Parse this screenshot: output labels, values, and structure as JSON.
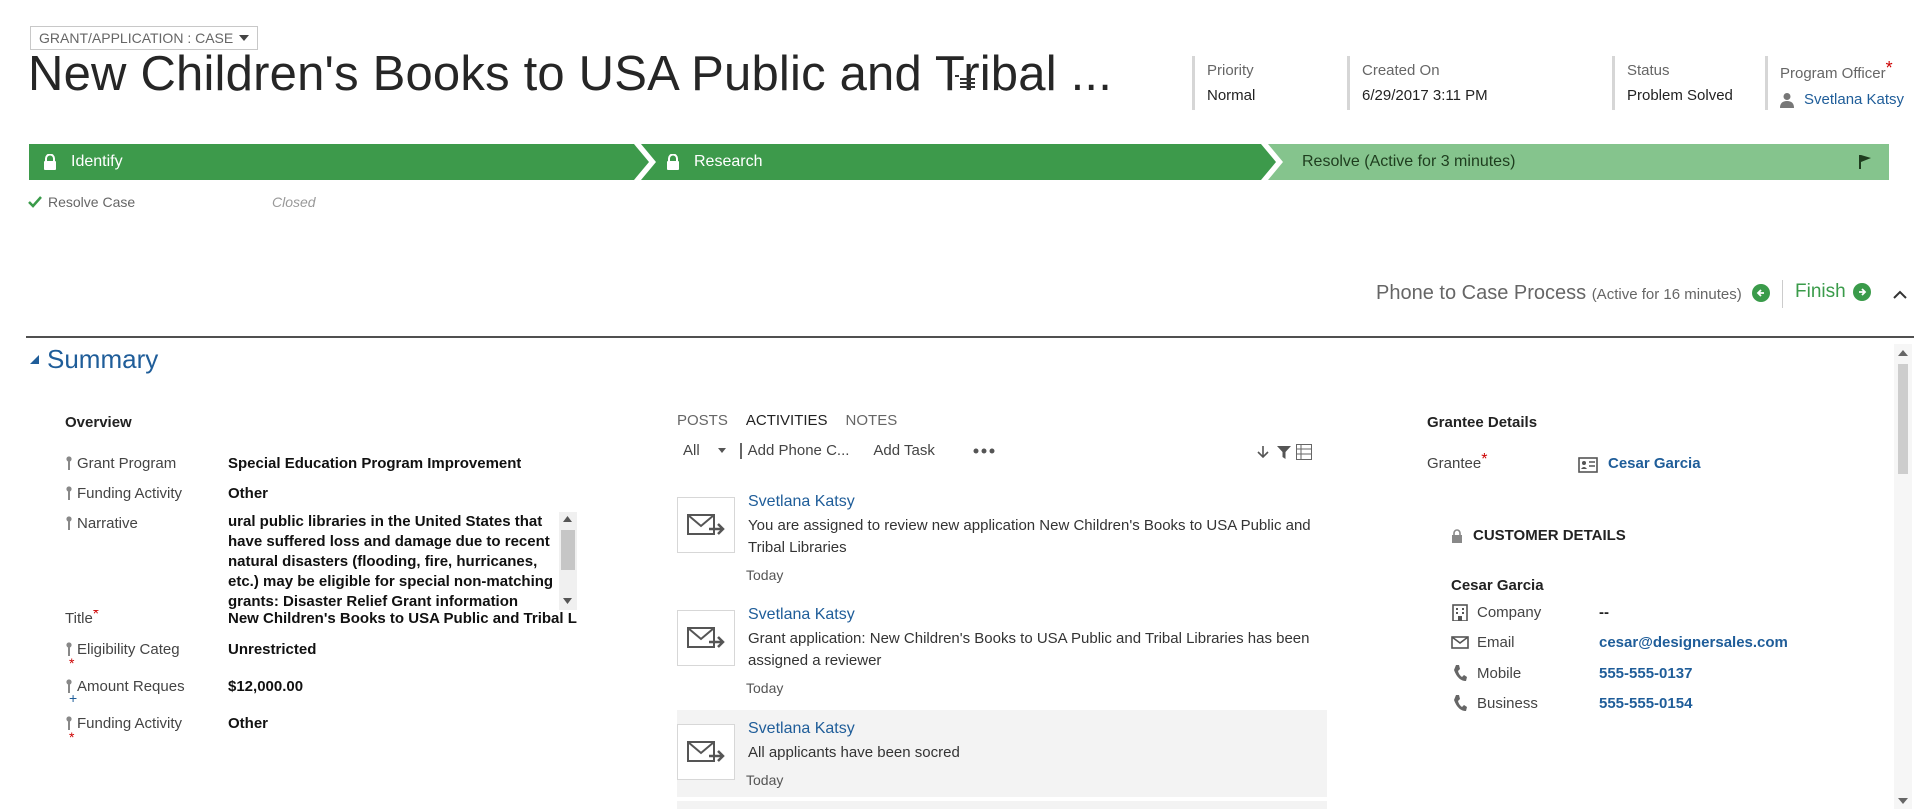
{
  "header": {
    "form_selector": "GRANT/APPLICATION : CASE",
    "title": "New Children's Books to USA Public and Tribal ...",
    "fields": {
      "priority_label": "Priority",
      "priority_value": "Normal",
      "created_label": "Created On",
      "created_value": "6/29/2017   3:11 PM",
      "status_label": "Status",
      "status_value": "Problem Solved",
      "officer_label": "Program Officer",
      "officer_value": "Svetlana Katsy"
    }
  },
  "process": {
    "stages": [
      {
        "label": "Identify"
      },
      {
        "label": "Research"
      },
      {
        "label": "Resolve (Active for 3 minutes)"
      }
    ],
    "step_label": "Resolve Case",
    "step_value": "Closed",
    "name": "Phone to Case Process",
    "active_text": "(Active for 16 minutes)",
    "finish_label": "Finish"
  },
  "section": {
    "title": "Summary"
  },
  "overview": {
    "title": "Overview",
    "grant_program_label": "Grant Program",
    "grant_program_value": "Special Education Program Improvement",
    "funding_activity_label": "Funding Activity",
    "funding_activity_value": "Other",
    "narrative_label": "Narrative",
    "narrative_value": "ural public libraries in the United States that have suffered loss and damage due to recent natural disasters (flooding, fire, hurricanes, etc.) may be eligible for special non-matching grants: Disaster Relief Grant information",
    "title_label": "Title",
    "title_value": "New Children's Books to USA Public and Tribal Libraries",
    "eligibility_label": "Eligibility Categ",
    "eligibility_value": "Unrestricted",
    "amount_label": "Amount Reques",
    "amount_value": "$12,000.00",
    "funding_activity2_label": "Funding Activity",
    "funding_activity2_value": "Other"
  },
  "activities": {
    "tabs": [
      "POSTS",
      "ACTIVITIES",
      "NOTES"
    ],
    "filter_value": "All",
    "add_phone": "Add Phone C...",
    "add_task": "Add Task",
    "items": [
      {
        "who": "Svetlana Katsy",
        "desc": "You are assigned to review new application New Children's Books to USA Public and Tribal Libraries",
        "when": "Today"
      },
      {
        "who": "Svetlana Katsy",
        "desc": "Grant application: New Children's Books to USA Public and Tribal Libraries has been assigned a reviewer",
        "when": "Today"
      },
      {
        "who": "Svetlana Katsy",
        "desc": "All applicants have been socred",
        "when": "Today"
      }
    ]
  },
  "grantee": {
    "title": "Grantee Details",
    "grantee_label": "Grantee",
    "grantee_value": "Cesar Garcia",
    "customer_details_title": "CUSTOMER DETAILS",
    "customer_name": "Cesar Garcia",
    "company_label": "Company",
    "company_value": "--",
    "email_label": "Email",
    "email_value": "cesar@designersales.com",
    "mobile_label": "Mobile",
    "mobile_value": "555-555-0137",
    "business_label": "Business",
    "business_value": "555-555-0154"
  },
  "colors": {
    "stage_active": "#3d9a4b",
    "stage_current": "#85c48d",
    "link": "#1f5d99",
    "required": "#cc0000"
  }
}
